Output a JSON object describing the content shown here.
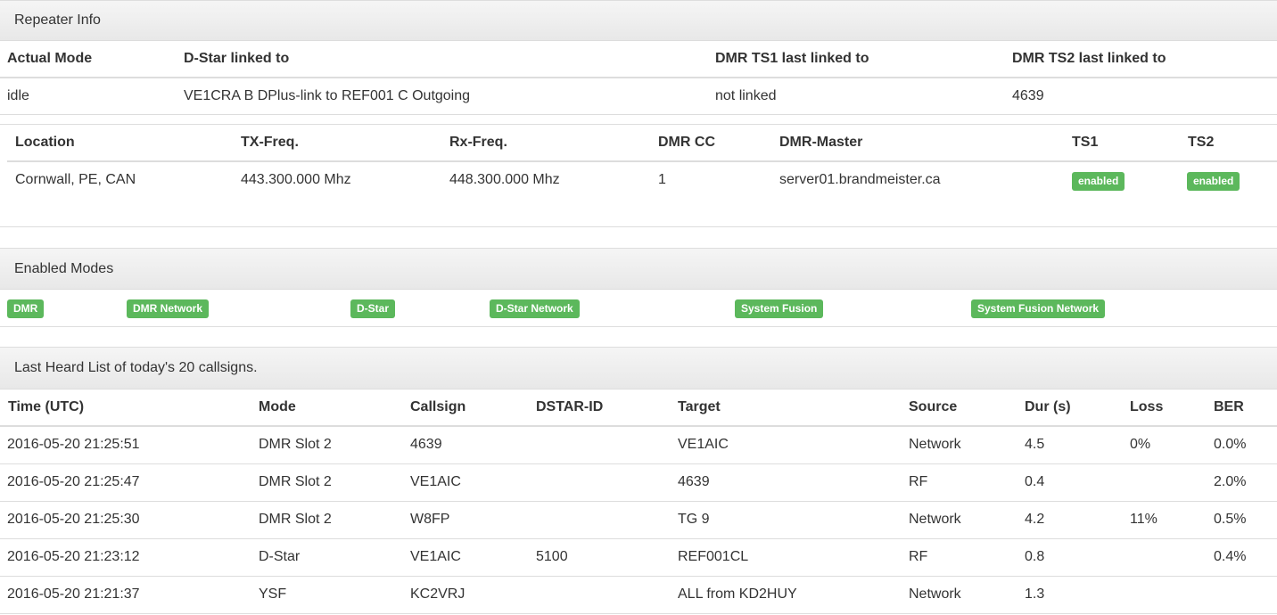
{
  "repeater_info": {
    "title": "Repeater Info",
    "headers": [
      "Actual Mode",
      "D-Star linked to",
      "DMR TS1 last linked to",
      "DMR TS2 last linked to"
    ],
    "values": [
      "idle",
      "VE1CRA B DPlus-link to REF001 C Outgoing",
      "not linked",
      "4639"
    ]
  },
  "location_table": {
    "headers": [
      "Location",
      "TX-Freq.",
      "Rx-Freq.",
      "DMR CC",
      "DMR-Master",
      "TS1",
      "TS2"
    ],
    "values": [
      "Cornwall, PE, CAN",
      "443.300.000 Mhz",
      "448.300.000 Mhz",
      "1",
      "server01.brandmeister.ca"
    ],
    "ts1_badge": "enabled",
    "ts2_badge": "enabled"
  },
  "enabled_modes": {
    "title": "Enabled Modes",
    "modes": [
      "DMR",
      "DMR Network",
      "D-Star",
      "D-Star Network",
      "System Fusion",
      "System Fusion Network"
    ]
  },
  "last_heard": {
    "title": "Last Heard List of today's 20 callsigns.",
    "headers": [
      "Time (UTC)",
      "Mode",
      "Callsign",
      "DSTAR-ID",
      "Target",
      "Source",
      "Dur (s)",
      "Loss",
      "BER"
    ],
    "rows": [
      [
        "2016-05-20 21:25:51",
        "DMR Slot 2",
        "4639",
        "",
        "VE1AIC",
        "Network",
        "4.5",
        "0%",
        "0.0%"
      ],
      [
        "2016-05-20 21:25:47",
        "DMR Slot 2",
        "VE1AIC",
        "",
        "4639",
        "RF",
        "0.4",
        "",
        "2.0%"
      ],
      [
        "2016-05-20 21:25:30",
        "DMR Slot 2",
        "W8FP",
        "",
        "TG 9",
        "Network",
        "4.2",
        "11%",
        "0.5%"
      ],
      [
        "2016-05-20 21:23:12",
        "D-Star",
        "VE1AIC",
        "5100",
        "REF001CL",
        "RF",
        "0.8",
        "",
        "0.4%"
      ],
      [
        "2016-05-20 21:21:37",
        "YSF",
        "KC2VRJ",
        "",
        "ALL from KD2HUY",
        "Network",
        "1.3",
        "",
        ""
      ]
    ]
  },
  "colors": {
    "badge_green": "#5cb85c",
    "border": "#dddddd",
    "heading_bg": "#f0f0f0"
  }
}
